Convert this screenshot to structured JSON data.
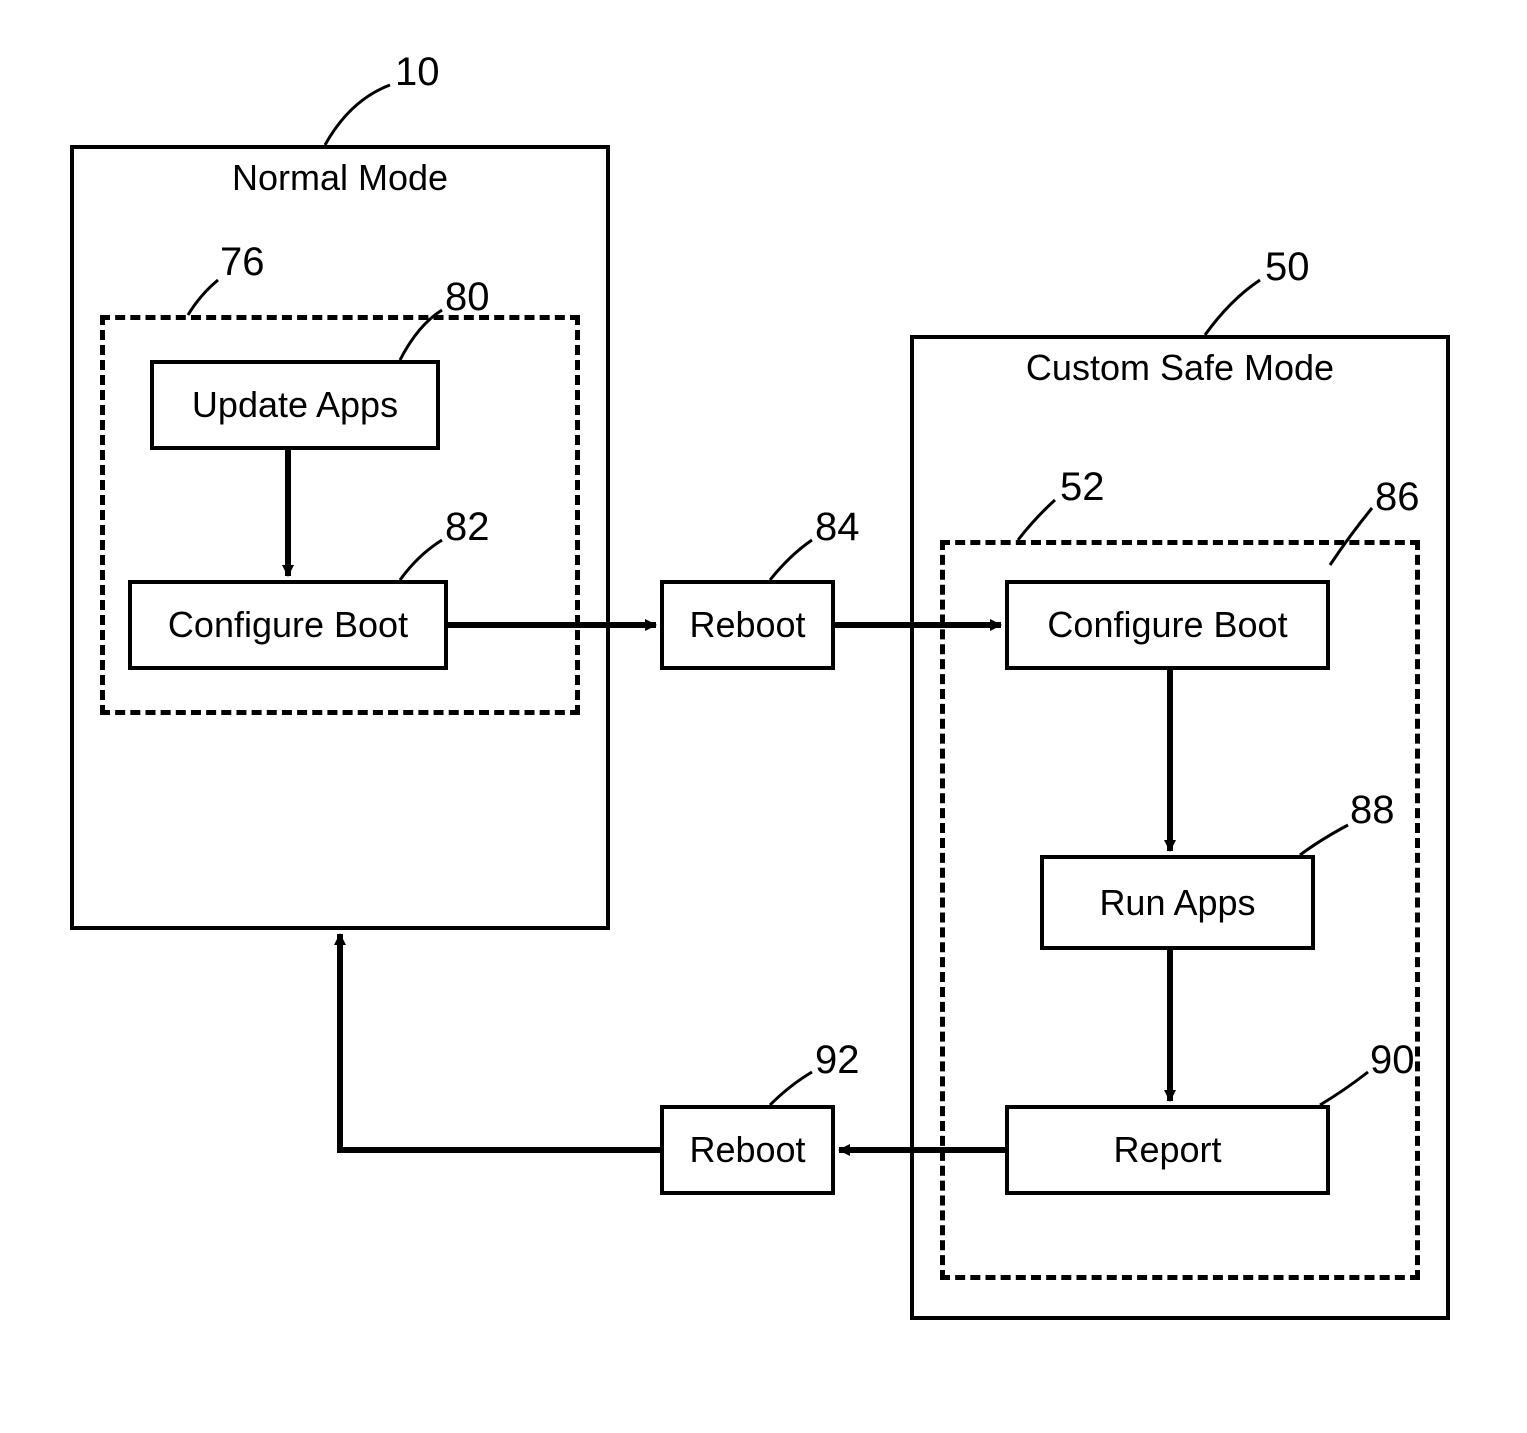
{
  "normal_mode": {
    "title": "Normal Mode",
    "ref": "10",
    "dashed_ref": "76",
    "update_apps_label": "Update Apps",
    "update_apps_ref": "80",
    "configure_boot_label": "Configure Boot",
    "configure_boot_ref": "82"
  },
  "reboot_mid": {
    "label": "Reboot",
    "ref": "84"
  },
  "safe_mode": {
    "title": "Custom Safe Mode",
    "ref": "50",
    "dashed_ref": "52",
    "configure_boot_label": "Configure Boot",
    "configure_boot_ref": "86",
    "run_apps_label": "Run Apps",
    "run_apps_ref": "88",
    "report_label": "Report",
    "report_ref": "90"
  },
  "reboot_low": {
    "label": "Reboot",
    "ref": "92"
  }
}
